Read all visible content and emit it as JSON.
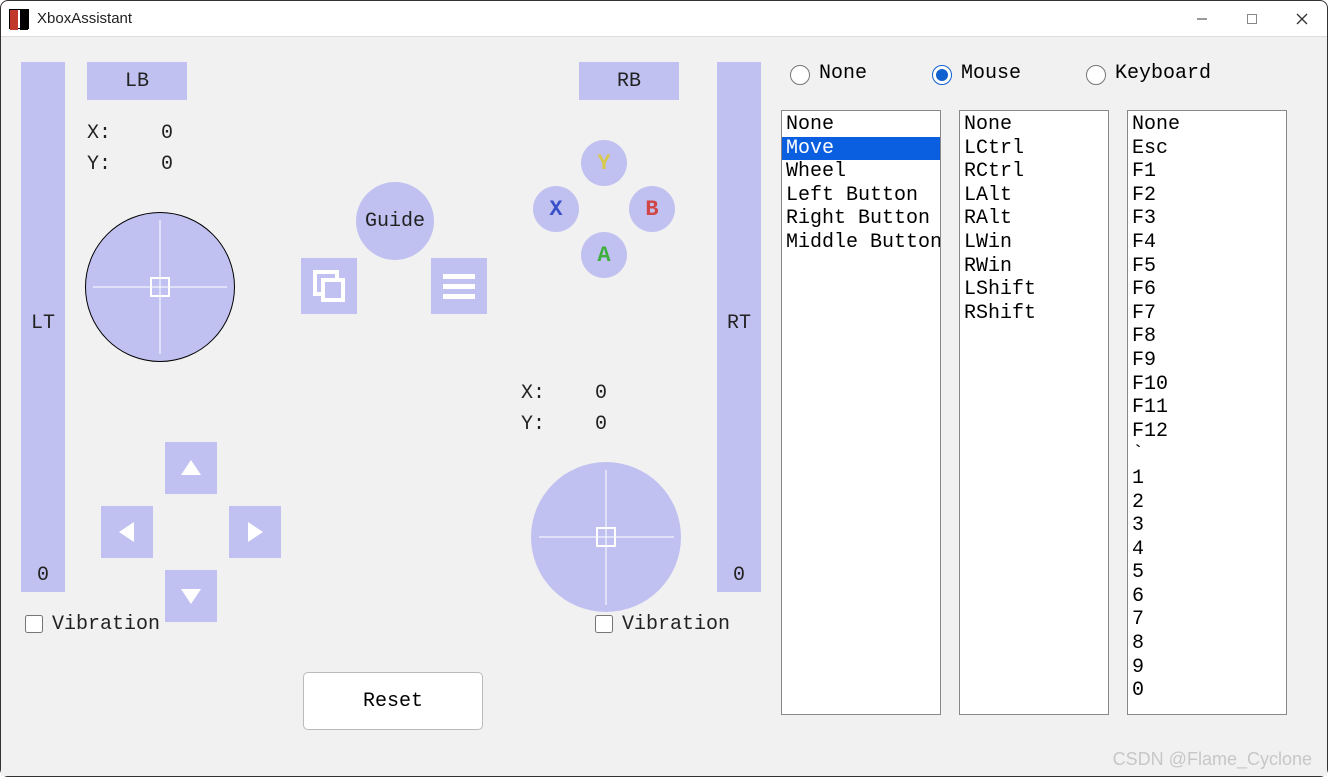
{
  "title": "XboxAssistant",
  "triggers": {
    "left": {
      "label": "LT",
      "value": "0"
    },
    "right": {
      "label": "RT",
      "value": "0"
    }
  },
  "bumpers": {
    "left": "LB",
    "right": "RB"
  },
  "sticks": {
    "left": {
      "x_label": "X:",
      "x": "0",
      "y_label": "Y:",
      "y": "0"
    },
    "right": {
      "x_label": "X:",
      "x": "0",
      "y_label": "Y:",
      "y": "0"
    }
  },
  "guide_label": "Guide",
  "face": {
    "y": "Y",
    "x": "X",
    "b": "B",
    "a": "A"
  },
  "vibration": {
    "left_label": "Vibration",
    "right_label": "Vibration",
    "left_checked": false,
    "right_checked": false
  },
  "reset_label": "Reset",
  "mapping": {
    "radios": {
      "none": "None",
      "mouse": "Mouse",
      "keyboard": "Keyboard",
      "selected": "mouse"
    },
    "list1": [
      "None",
      "Move",
      "Wheel",
      "Left Button",
      "Right Button",
      "Middle Button"
    ],
    "list1_selected": "Move",
    "list2": [
      "None",
      "LCtrl",
      "RCtrl",
      "LAlt",
      "RAlt",
      "LWin",
      "RWin",
      "LShift",
      "RShift"
    ],
    "list3": [
      "None",
      "Esc",
      "F1",
      "F2",
      "F3",
      "F4",
      "F5",
      "F6",
      "F7",
      "F8",
      "F9",
      "F10",
      "F11",
      "F12",
      "`",
      "1",
      "2",
      "3",
      "4",
      "5",
      "6",
      "7",
      "8",
      "9",
      "0"
    ]
  },
  "watermark": "CSDN @Flame_Cyclone"
}
